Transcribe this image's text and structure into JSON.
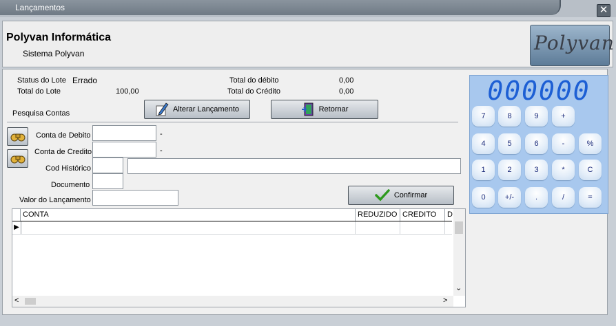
{
  "window": {
    "title": "Lançamentos",
    "close_glyph": "✕"
  },
  "header": {
    "company": "Polyvan Informática",
    "system": "Sistema Polyvan",
    "logo_text": "Polyvan"
  },
  "summary": {
    "status_label": "Status do Lote",
    "status_value": "Errado",
    "total_lote_label": "Total do Lote",
    "total_lote_value": "100,00",
    "total_debito_label": "Total do débito",
    "total_debito_value": "0,00",
    "total_credito_label": "Total do Crédito",
    "total_credito_value": "0,00"
  },
  "search": {
    "label": "Pesquisa Contas"
  },
  "buttons": {
    "alterar": "Alterar Lançamento",
    "retornar": "Retornar",
    "confirmar": "Confirmar"
  },
  "form": {
    "conta_debito_label": "Conta de Debito",
    "conta_debito_value": "",
    "conta_debito_desc": "-",
    "conta_credito_label": "Conta de Credito",
    "conta_credito_value": "",
    "conta_credito_desc": "-",
    "cod_historico_label": "Cod Histórico",
    "cod_historico_value": "",
    "historico_desc_value": "",
    "documento_label": "Documento",
    "documento_value": "",
    "valor_label": "Valor do Lançamento",
    "valor_value": ""
  },
  "grid": {
    "columns": [
      "CONTA",
      "REDUZIDO",
      "CREDITO",
      "D"
    ],
    "row_indicator": "▶",
    "scroll_left": "<",
    "scroll_right": ">",
    "scroll_down": "⌄"
  },
  "calculator": {
    "display": "000000",
    "keys": [
      "7",
      "8",
      "9",
      "+",
      "4",
      "5",
      "6",
      "-",
      "%",
      "1",
      "2",
      "3",
      "*",
      "C",
      "0",
      "+/-",
      ".",
      "/",
      "="
    ]
  },
  "colors": {
    "lcd": "#1d5fd4",
    "calc_bg": "#a8c8ee",
    "confirm_check": "#2e9a1e"
  }
}
